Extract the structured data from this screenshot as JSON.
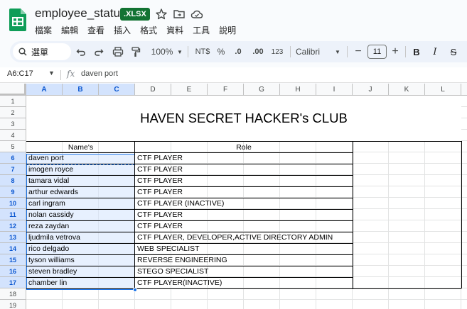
{
  "app": {
    "doc_title": "employee_status",
    "file_badge": ".XLSX",
    "menus": [
      "檔案",
      "編輯",
      "查看",
      "插入",
      "格式",
      "資料",
      "工具",
      "說明"
    ]
  },
  "toolbar": {
    "search_label": "選單",
    "zoom": "100%",
    "currency": "NT$",
    "percent": "%",
    "decrease_decimal": ".0",
    "increase_decimal": ".00",
    "number_format": "123",
    "font": "Calibri",
    "font_size": "11"
  },
  "formula_bar": {
    "name_box": "A6:C17",
    "formula": "daven port"
  },
  "columns": [
    "A",
    "B",
    "C",
    "D",
    "E",
    "F",
    "G",
    "H",
    "I",
    "J",
    "K",
    "L"
  ],
  "rows": [
    "1",
    "2",
    "3",
    "4",
    "5",
    "6",
    "7",
    "8",
    "9",
    "10",
    "11",
    "12",
    "13",
    "14",
    "15",
    "16",
    "17",
    "18",
    "19"
  ],
  "sheet": {
    "title": "HAVEN SECRET HACKER's CLUB",
    "headers": {
      "name": "Name's",
      "role": "Role"
    },
    "entries": [
      {
        "name": "daven port",
        "role": "CTF PLAYER"
      },
      {
        "name": "imogen royce",
        "role": "CTF PLAYER"
      },
      {
        "name": "tamara vidal",
        "role": "CTF PLAYER"
      },
      {
        "name": "arthur edwards",
        "role": "CTF PLAYER"
      },
      {
        "name": "carl ingram",
        "role": "CTF PLAYER (INACTIVE)"
      },
      {
        "name": "nolan cassidy",
        "role": "CTF PLAYER"
      },
      {
        "name": "reza zaydan",
        "role": "CTF PLAYER"
      },
      {
        "name": "ljudmila vetrova",
        "role": "CTF PLAYER, DEVELOPER,ACTIVE DIRECTORY ADMIN"
      },
      {
        "name": "rico delgado",
        "role": "WEB SPECIALIST"
      },
      {
        "name": "tyson williams",
        "role": "REVERSE ENGINEERING"
      },
      {
        "name": "steven bradley",
        "role": "STEGO SPECIALIST"
      },
      {
        "name": "chamber lin",
        "role": "CTF PLAYER(INACTIVE)"
      }
    ]
  },
  "colors": {
    "brand_green": "#0f9d58",
    "badge_green": "#137333",
    "selection": "#1a73e8"
  }
}
